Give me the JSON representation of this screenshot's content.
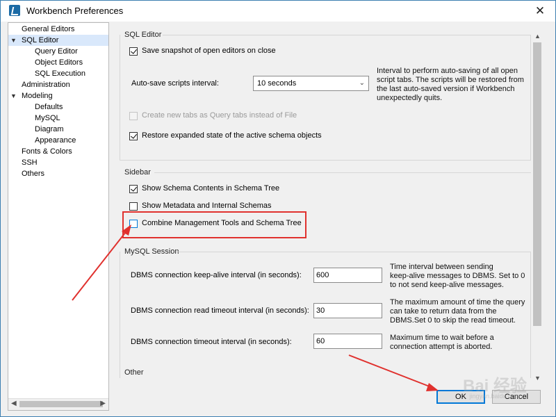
{
  "window": {
    "title": "Workbench Preferences",
    "close_glyph": "✕"
  },
  "tree": {
    "items": [
      {
        "label": "General Editors"
      },
      {
        "label": "SQL Editor"
      },
      {
        "label": "Query Editor"
      },
      {
        "label": "Object Editors"
      },
      {
        "label": "SQL Execution"
      },
      {
        "label": "Administration"
      },
      {
        "label": "Modeling"
      },
      {
        "label": "Defaults"
      },
      {
        "label": "MySQL"
      },
      {
        "label": "Diagram"
      },
      {
        "label": "Appearance"
      },
      {
        "label": "Fonts & Colors"
      },
      {
        "label": "SSH"
      },
      {
        "label": "Others"
      }
    ],
    "selected": "SQL Editor",
    "expand_glyph": "▼"
  },
  "sql_editor": {
    "title": "SQL Editor",
    "save_snapshot": {
      "label": "Save snapshot of open editors on close",
      "checked": true
    },
    "autosave_label": "Auto-save scripts interval:",
    "autosave_value": "10 seconds",
    "autosave_help": [
      "Interval to perform auto-saving of all open",
      "script tabs. The scripts will be restored from",
      "the last auto-saved version if Workbench",
      "unexpectedly quits."
    ],
    "query_tabs": {
      "label": "Create new tabs as Query tabs instead of File",
      "checked": false,
      "disabled": true
    },
    "restore_state": {
      "label": "Restore expanded state of the active schema objects",
      "checked": true
    }
  },
  "sidebar": {
    "title": "Sidebar",
    "show_schema": {
      "label": "Show Schema Contents in Schema Tree",
      "checked": true
    },
    "show_metadata": {
      "label": "Show Metadata and Internal Schemas",
      "checked": false
    },
    "combine_tools": {
      "label": "Combine Management Tools and Schema Tree",
      "checked": false
    }
  },
  "mysql_session": {
    "title": "MySQL Session",
    "keepalive": {
      "label": "DBMS connection keep-alive interval (in seconds):",
      "value": "600",
      "help": [
        "Time interval between sending",
        "keep-alive messages to DBMS. Set to 0",
        "to not send keep-alive messages."
      ]
    },
    "read_timeout": {
      "label": "DBMS connection read timeout interval (in seconds):",
      "value": "30",
      "help": [
        "The maximum amount of time the query",
        "can take to return data from the",
        "DBMS.Set 0 to skip the read timeout."
      ]
    },
    "conn_timeout": {
      "label": "DBMS connection timeout interval (in seconds):",
      "value": "60",
      "help": [
        "Maximum time to wait before a",
        "connection attempt is aborted."
      ]
    }
  },
  "other": {
    "title": "Other"
  },
  "buttons": {
    "ok": "OK",
    "cancel": "Cancel"
  },
  "watermark": {
    "text": "Bai 经验",
    "sub": "jingyan.baidu.com"
  },
  "colors": {
    "accent": "#0078d7",
    "annotation": "#e0312e",
    "selection": "#d9e8fb"
  }
}
